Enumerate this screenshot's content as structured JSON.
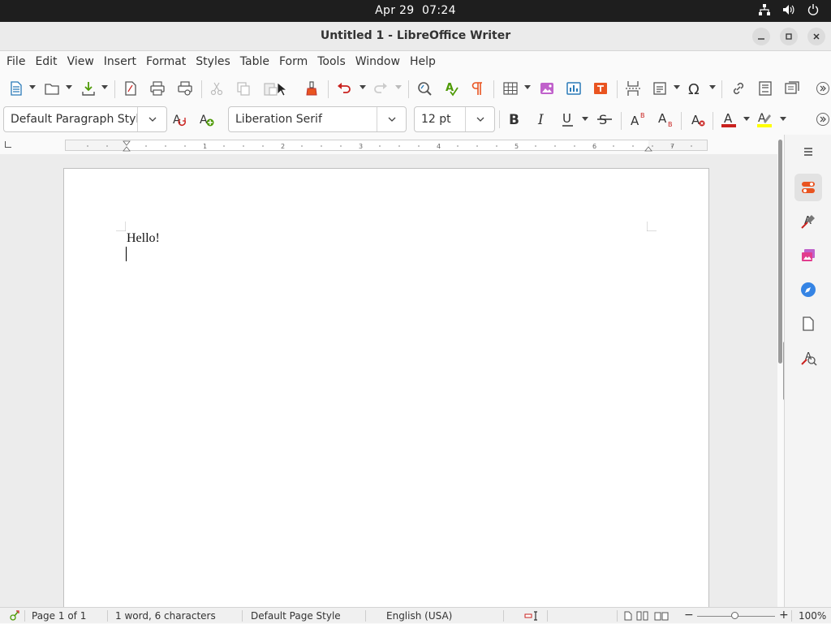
{
  "topbar": {
    "date": "Apr 29",
    "time": "07:24",
    "icons": [
      "network-icon",
      "volume-icon",
      "power-icon"
    ]
  },
  "window": {
    "title": "Untitled 1 - LibreOffice Writer"
  },
  "menubar": {
    "items": [
      "File",
      "Edit",
      "View",
      "Insert",
      "Format",
      "Styles",
      "Table",
      "Form",
      "Tools",
      "Window",
      "Help"
    ]
  },
  "formatting": {
    "paragraph_style": "Default Paragraph Styl",
    "font_name": "Liberation Serif",
    "font_size": "12 pt"
  },
  "document": {
    "text": "Hello!"
  },
  "statusbar": {
    "page": "Page 1 of 1",
    "word_count": "1 word, 6 characters",
    "page_style": "Default Page Style",
    "language": "English (USA)",
    "zoom": "100%",
    "zoom_level": 1.0
  },
  "colors": {
    "accent_orange": "#e95420",
    "font_color_bar": "#c9211e",
    "highlight_bar": "#ffff00"
  }
}
